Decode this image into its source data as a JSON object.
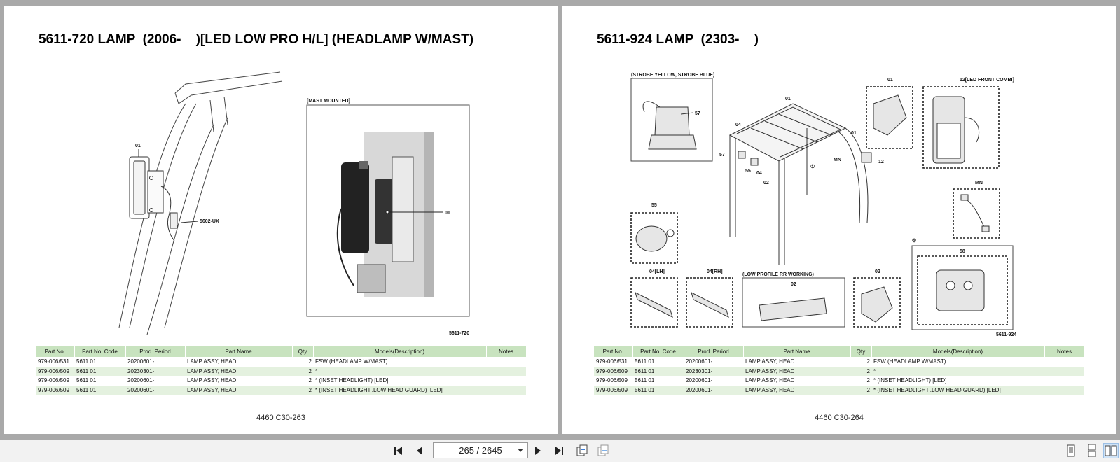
{
  "pages": [
    {
      "title": "5611-720 LAMP  (2006-    )[LED LOW PRO H/L] (HEADLAMP W/MAST)",
      "diagram": {
        "frame_label": "[MAST MOUNTED]",
        "callouts": [
          "01",
          "5602-UX",
          "01"
        ],
        "ref": "5611-720"
      },
      "table": {
        "headers": [
          "Part No.",
          "Part No. Code",
          "Prod. Period",
          "Part Name",
          "Qty",
          "Models(Description)",
          "Notes"
        ],
        "rows": [
          [
            "979-006/531",
            "5611 01",
            "20200601-",
            "LAMP ASSY, HEAD",
            "2",
            "FSW (HEADLAMP W/MAST)",
            ""
          ],
          [
            "979-006/509",
            "5611 01",
            "20230301-",
            "LAMP ASSY, HEAD",
            "2",
            "*",
            ""
          ],
          [
            "979-006/509",
            "5611 01",
            "20200601-",
            "LAMP ASSY, HEAD",
            "2",
            "* (INSET HEADLIGHT) [LED]",
            ""
          ],
          [
            "979-006/509",
            "5611 01",
            "20200601-",
            "LAMP ASSY, HEAD",
            "2",
            "* (INSET HEADLIGHT..LOW HEAD GUARD) [LED]",
            ""
          ]
        ]
      },
      "footer": "4460 C30-263"
    },
    {
      "title": "5611-924 LAMP  (2303-    )",
      "diagram": {
        "labels": [
          "(STROBE YELLOW, STROBE BLUE)",
          "01",
          "12[LED FRONT COMBI]",
          "57",
          "01",
          "04",
          "01",
          "57",
          "55",
          "04",
          "02",
          "MN",
          "12",
          "MN",
          "55",
          "04[LH]",
          "04[RH]",
          "(LOW PROFILE RR WORKING)",
          "02",
          "02",
          "58",
          "①",
          "①"
        ],
        "ref": "5611-924"
      },
      "table": {
        "headers": [
          "Part No.",
          "Part No. Code",
          "Prod. Period",
          "Part Name",
          "Qty",
          "Models(Description)",
          "Notes"
        ],
        "rows": [
          [
            "979-006/531",
            "5611 01",
            "20200601-",
            "LAMP ASSY, HEAD",
            "2",
            "FSW (HEADLAMP W/MAST)",
            ""
          ],
          [
            "979-006/509",
            "5611 01",
            "20230301-",
            "LAMP ASSY, HEAD",
            "2",
            "*",
            ""
          ],
          [
            "979-006/509",
            "5611 01",
            "20200601-",
            "LAMP ASSY, HEAD",
            "2",
            "* (INSET HEADLIGHT) [LED]",
            ""
          ],
          [
            "979-006/509",
            "5611 01",
            "20200601-",
            "LAMP ASSY, HEAD",
            "2",
            "* (INSET HEADLIGHT..LOW HEAD GUARD) [LED]",
            ""
          ]
        ]
      },
      "footer": "4460 C30-264"
    }
  ],
  "toolbar": {
    "page_indicator": "265 / 2645",
    "buttons": [
      "first-page-icon",
      "prev-page-icon",
      "next-page-icon",
      "last-page-icon",
      "fit-page-icon",
      "fit-width-icon",
      "single-page-icon",
      "continuous-icon",
      "two-page-icon"
    ],
    "active_view": "two-page"
  }
}
